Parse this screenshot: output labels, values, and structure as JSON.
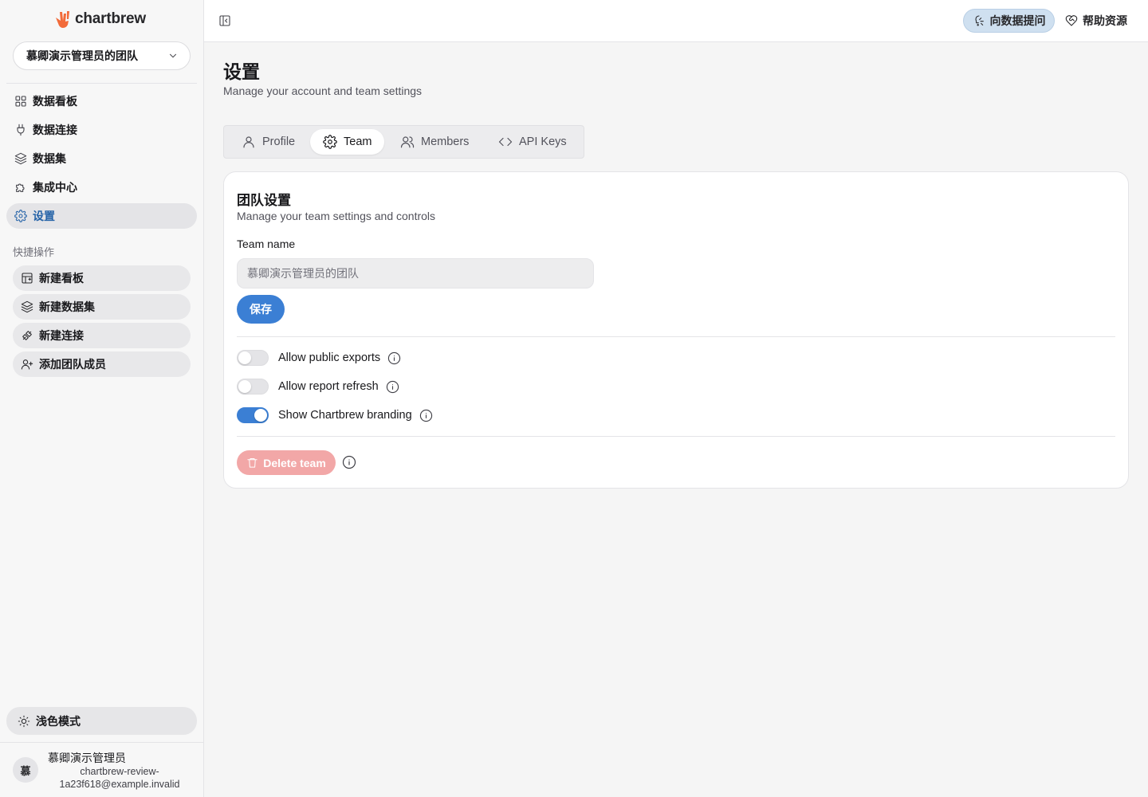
{
  "brand": {
    "name": "chartbrew",
    "accent": "#3b7fd4",
    "logo_color": "#f26b3a"
  },
  "sidebar": {
    "team_select": {
      "value": "慕卿演示管理员的团队"
    },
    "nav": [
      {
        "label": "数据看板",
        "icon": "grid-icon"
      },
      {
        "label": "数据连接",
        "icon": "plug-icon"
      },
      {
        "label": "数据集",
        "icon": "layers-icon"
      },
      {
        "label": "集成中心",
        "icon": "puzzle-icon"
      },
      {
        "label": "设置",
        "icon": "gear-icon",
        "active": true
      }
    ],
    "quick_actions_title": "快捷操作",
    "quick_actions": [
      {
        "label": "新建看板",
        "icon": "dashboard-plus-icon"
      },
      {
        "label": "新建数据集",
        "icon": "layers-plus-icon"
      },
      {
        "label": "新建连接",
        "icon": "plug-plus-icon"
      },
      {
        "label": "添加团队成员",
        "icon": "user-plus-icon"
      }
    ],
    "theme_toggle": {
      "label": "浅色模式",
      "icon": "sun-icon"
    },
    "user": {
      "avatar": "慕",
      "name": "慕卿演示管理员",
      "email": "chartbrew-review-1a23f618@example.invalid"
    }
  },
  "topbar": {
    "ask_label": "向数据提问",
    "help_label": "帮助资源"
  },
  "main": {
    "title": "设置",
    "subtitle": "Manage your account and team settings",
    "tabs": [
      {
        "label": "Profile",
        "icon": "user-icon"
      },
      {
        "label": "Team",
        "icon": "gear-icon",
        "active": true
      },
      {
        "label": "Members",
        "icon": "users-icon"
      },
      {
        "label": "API Keys",
        "icon": "code-icon"
      }
    ],
    "card": {
      "title": "团队设置",
      "subtitle": "Manage your team settings and controls",
      "team_name_label": "Team name",
      "team_name_value": "慕卿演示管理员的团队",
      "save_label": "保存",
      "toggles": [
        {
          "label": "Allow public exports",
          "on": false
        },
        {
          "label": "Allow report refresh",
          "on": false
        },
        {
          "label": "Show Chartbrew branding",
          "on": true
        }
      ],
      "delete_label": "Delete team"
    }
  }
}
